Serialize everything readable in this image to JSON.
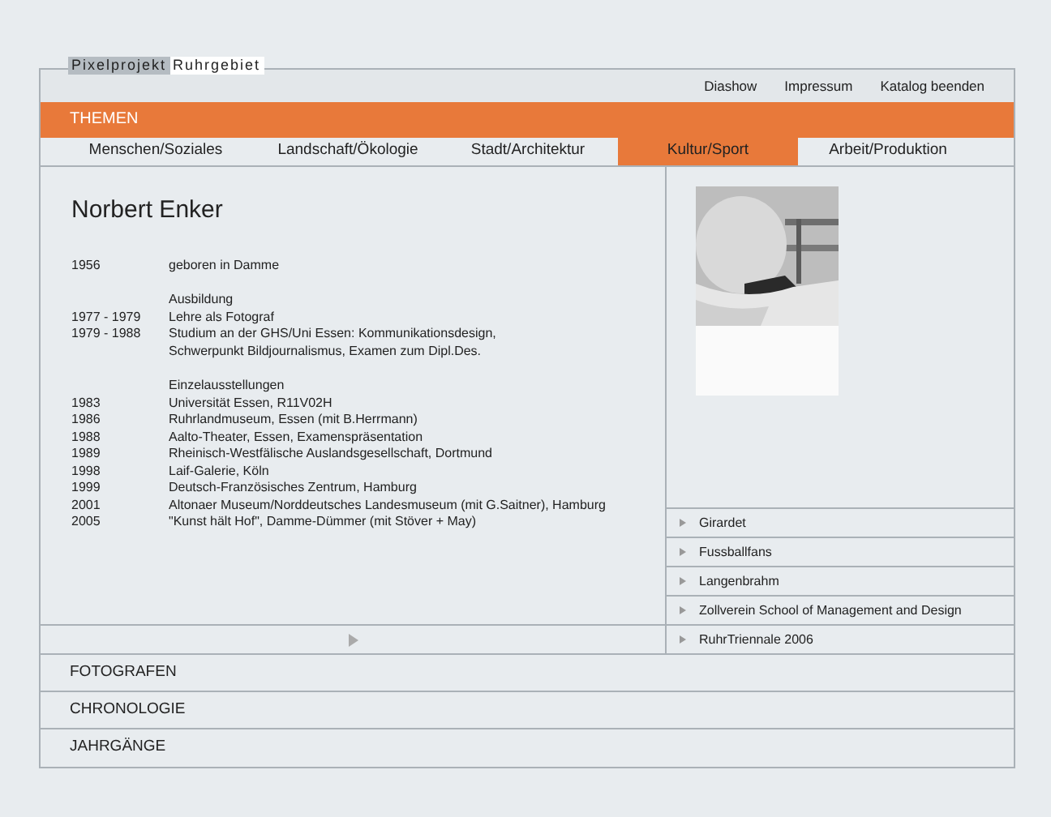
{
  "logo": {
    "part_1": "Pixelprojekt",
    "part_2": "Ruhrgebiet"
  },
  "top_links": [
    "Diashow",
    "Impressum",
    "Katalog beenden"
  ],
  "themes_bar": {
    "title": "THEMEN"
  },
  "tabs": [
    {
      "label": "Menschen/Soziales",
      "selected": false
    },
    {
      "label": "Landschaft/Ökologie",
      "selected": false
    },
    {
      "label": "Stadt/Architektur",
      "selected": false
    },
    {
      "label": "Kultur/Sport",
      "selected": true
    },
    {
      "label": "Arbeit/Produktion",
      "selected": false
    }
  ],
  "person": {
    "name": "Norbert Enker"
  },
  "bio_sections": [
    {
      "rows": [
        {
          "year": "1956",
          "text": "geboren in Damme"
        }
      ]
    },
    {
      "heading": "Ausbildung",
      "rows": [
        {
          "year": "1977 - 1979",
          "text": "Lehre als Fotograf"
        },
        {
          "year": "1979 - 1988",
          "text": "Studium an der GHS/Uni Essen: Kommunikationsdesign,",
          "continuation": "Schwerpunkt Bildjournalismus, Examen zum Dipl.Des."
        }
      ]
    },
    {
      "heading": "Einzelausstellungen",
      "rows": [
        {
          "year": "1983",
          "text": "Universität Essen, R11V02H"
        },
        {
          "year": "1986",
          "text": "Ruhrlandmuseum, Essen (mit B.Herrmann)"
        },
        {
          "year": "1988",
          "text": "Aalto-Theater, Essen, Examenspräsentation"
        },
        {
          "year": "1989",
          "text": "Rheinisch-Westfälische Auslandsgesellschaft, Dortmund"
        },
        {
          "year": "1998",
          "text": "Laif-Galerie, Köln"
        },
        {
          "year": "1999",
          "text": "Deutsch-Französisches Zentrum, Hamburg"
        },
        {
          "year": "2001",
          "text": "Altonaer Museum/Norddeutsches Landesmuseum (mit G.Saitner), Hamburg"
        },
        {
          "year": "2005",
          "text": "\"Kunst hält Hof\", Damme-Dümmer (mit Stöver + May)"
        }
      ]
    }
  ],
  "projects": [
    "Girardet",
    "Fussballfans",
    "Langenbrahm",
    "Zollverein School of Management and Design",
    "RuhrTriennale 2006"
  ],
  "sections": [
    "FOTOGRAFEN",
    "CHRONOLOGIE",
    "JAHRGÄNGE"
  ]
}
